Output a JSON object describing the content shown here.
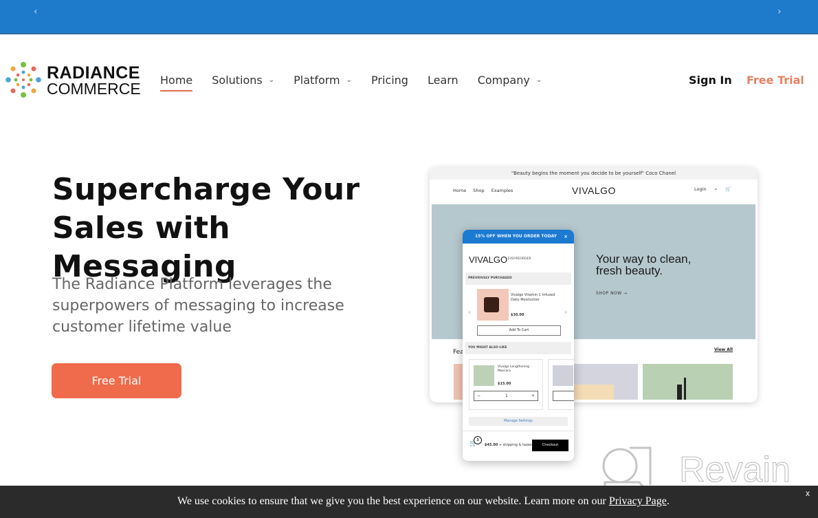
{
  "topbar": {
    "prev_icon": "‹",
    "next_icon": "›"
  },
  "brand": {
    "line1": "RADIANCE",
    "line2": "COMMERCE"
  },
  "nav": {
    "items": [
      {
        "label": "Home",
        "active": true,
        "has_dropdown": false
      },
      {
        "label": "Solutions",
        "has_dropdown": true
      },
      {
        "label": "Platform",
        "has_dropdown": true
      },
      {
        "label": "Pricing",
        "has_dropdown": false
      },
      {
        "label": "Learn",
        "has_dropdown": false
      },
      {
        "label": "Company",
        "has_dropdown": true
      }
    ],
    "chevron": "⌄",
    "sign_in": "Sign In",
    "free_trial": "Free Trial"
  },
  "hero": {
    "title": "Supercharge Your Sales with Messaging",
    "subtitle": "The Radiance Platform leverages the superpowers of messaging to increase customer lifetime value",
    "cta": "Free Trial"
  },
  "mockup": {
    "quote": "\"Beauty begins the moment you decide to be yourself\" Coco Chanel",
    "nav_left": [
      "Home",
      "Shop",
      "Examples"
    ],
    "logo": "VIVALGO",
    "nav_right": [
      "Login",
      "⌕",
      "🛒"
    ],
    "banner_title": "Your way to clean, fresh beauty.",
    "shop_now": "SHOP NOW →",
    "featured": "Fea",
    "view_all": "View All"
  },
  "phone": {
    "promo": "15% OFF WHEN YOU ORDER TODAY",
    "promo_close": "×",
    "logo": "VIVALGO",
    "easyreorder": "EASYREORDER",
    "previously_purchased": "PREVIOUSLY PURCHASED",
    "product1": {
      "name": "Vivalgo Vitamin C Infused Daily Moisturizer",
      "price": "$30.00"
    },
    "prev": "‹",
    "next": "›",
    "add_to_cart": "Add To Cart",
    "you_might_like": "YOU MIGHT ALSO LIKE",
    "product2": {
      "name": "Vivalgo Lengthening Mascara",
      "price": "$15.00",
      "qty": "1",
      "minus": "−",
      "plus": "+"
    },
    "manage_settings": "Manage Settings",
    "cart_count": "3",
    "total": "$45.00",
    "total_suffix": " + shipping & taxes",
    "checkout": "Checkout"
  },
  "watermark": {
    "text": "Revain"
  },
  "cookie": {
    "message": "We use cookies to ensure that we give you the best experience on our website. Learn more on our ",
    "link": "Privacy Page",
    "end": ".",
    "close": "x"
  }
}
